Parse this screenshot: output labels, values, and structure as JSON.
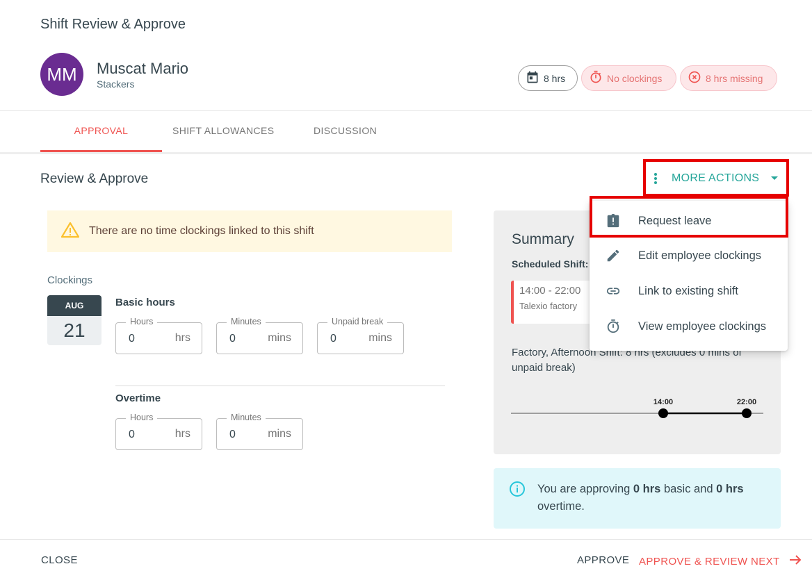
{
  "dialog": {
    "title": "Shift Review & Approve"
  },
  "employee": {
    "initials": "MM",
    "name": "Muscat Mario",
    "team": "Stackers",
    "avatar_color": "#6a2c91"
  },
  "chips": {
    "scheduled": "8 hrs",
    "no_clockings": "No clockings",
    "missing": "8 hrs missing"
  },
  "tabs": [
    {
      "label": "APPROVAL",
      "active": true
    },
    {
      "label": "SHIFT ALLOWANCES"
    },
    {
      "label": "DISCUSSION"
    }
  ],
  "section": {
    "title": "Review & Approve",
    "more_actions": "MORE ACTIONS"
  },
  "warning": {
    "text": "There are no time clockings linked to this shift"
  },
  "clockings": {
    "label": "Clockings",
    "date": {
      "month": "AUG",
      "day": "21"
    },
    "basic": {
      "title": "Basic hours",
      "hours": {
        "label": "Hours",
        "value": "0",
        "unit": "hrs"
      },
      "minutes": {
        "label": "Minutes",
        "value": "0",
        "unit": "mins"
      },
      "break": {
        "label": "Unpaid break",
        "value": "0",
        "unit": "mins"
      }
    },
    "overtime": {
      "title": "Overtime",
      "hours": {
        "label": "Hours",
        "value": "0",
        "unit": "hrs"
      },
      "minutes": {
        "label": "Minutes",
        "value": "0",
        "unit": "mins"
      }
    }
  },
  "summary": {
    "title": "Summary",
    "scheduled_label": "Scheduled Shift:",
    "shift_time": "14:00 - 22:00",
    "shift_location": "Talexio factory",
    "description": "Factory, Afternoon Shift: 8 hrs (excludes 0 mins of unpaid break)",
    "timeline": {
      "start": "14:00",
      "end": "22:00"
    }
  },
  "info": {
    "prefix": "You are approving ",
    "basic": "0 hrs",
    "middle": " basic and ",
    "overtime": "0 hrs",
    "suffix": " overtime."
  },
  "menu": {
    "items": [
      {
        "label": "Request leave",
        "icon": "clipboard-alert-icon"
      },
      {
        "label": "Edit employee clockings",
        "icon": "pencil-icon"
      },
      {
        "label": "Link to existing shift",
        "icon": "link-icon"
      },
      {
        "label": "View employee clockings",
        "icon": "timer-icon"
      }
    ]
  },
  "footer": {
    "close": "CLOSE",
    "approve": "APPROVE",
    "approve_next": "APPROVE & REVIEW NEXT"
  },
  "colors": {
    "accent": "#ef5350",
    "teal": "#26a69a",
    "highlight": "#e60000"
  }
}
